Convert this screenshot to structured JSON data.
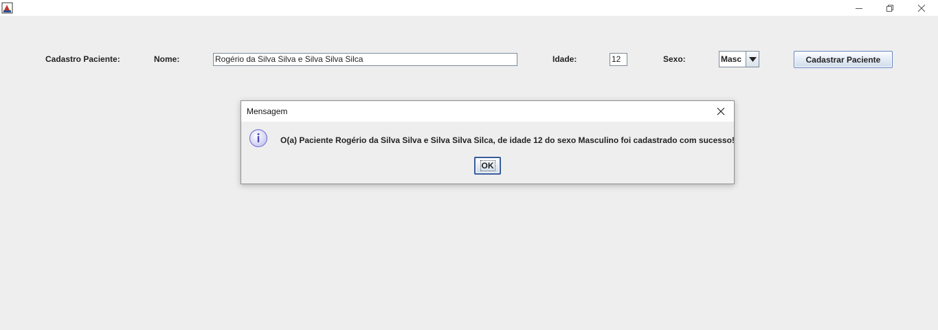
{
  "window": {
    "icons": {
      "app": "java-app-icon",
      "minimize": "minimize-icon",
      "maximize": "restore-icon",
      "close": "close-icon"
    }
  },
  "form": {
    "section_label": "Cadastro Paciente:",
    "name_label": "Nome:",
    "name_value": "Rogério da Silva Silva e Silva Silva Silca",
    "age_label": "Idade:",
    "age_value": "12",
    "sex_label": "Sexo:",
    "sex_selected": "Masc",
    "submit_label": "Cadastrar Paciente"
  },
  "dialog": {
    "title": "Mensagem",
    "message": "O(a) Paciente Rogério da Silva Silva e Silva Silva Silca, de idade 12 do sexo Masculino foi cadastrado com sucesso!",
    "ok_label": "OK",
    "icon": "info-icon"
  },
  "colors": {
    "background": "#eeeeee",
    "button_border": "#6382bf",
    "info_icon": "#8a8ad8"
  }
}
